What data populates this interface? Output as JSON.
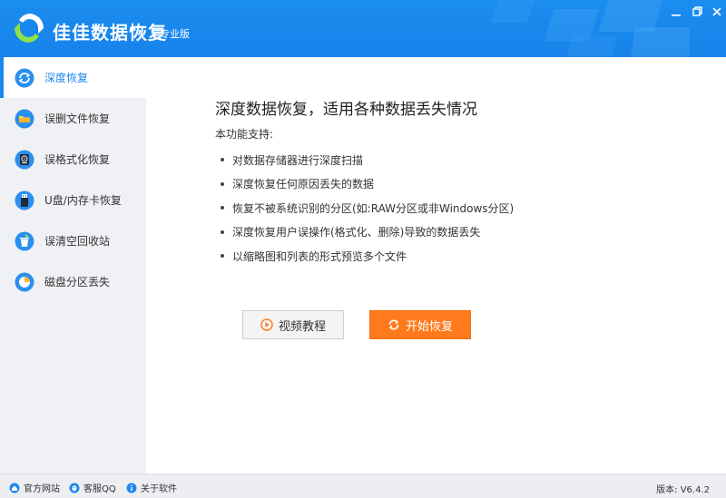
{
  "app": {
    "title": "佳佳数据恢复",
    "edition": "专业版"
  },
  "window_controls": {
    "minimize": "minimize-icon",
    "maximize": "maximize-icon",
    "close": "close-icon"
  },
  "sidebar": {
    "items": [
      {
        "label": "深度恢复",
        "icon": "refresh-icon",
        "active": true
      },
      {
        "label": "误删文件恢复",
        "icon": "folder-icon",
        "active": false
      },
      {
        "label": "误格式化恢复",
        "icon": "disk-icon",
        "active": false
      },
      {
        "label": "U盘/内存卡恢复",
        "icon": "usb-drive-icon",
        "active": false
      },
      {
        "label": "误清空回收站",
        "icon": "recycle-bin-icon",
        "active": false
      },
      {
        "label": "磁盘分区丢失",
        "icon": "partition-icon",
        "active": false
      }
    ]
  },
  "main": {
    "heading": "深度数据恢复，适用各种数据丢失情况",
    "subhead": "本功能支持:",
    "features": [
      "对数据存储器进行深度扫描",
      "深度恢复任何原因丢失的数据",
      "恢复不被系统识别的分区(如:RAW分区或非Windows分区)",
      "深度恢复用户误操作(格式化、删除)导致的数据丢失",
      "以缩略图和列表的形式预览多个文件"
    ],
    "video_button": "视频教程",
    "start_button": "开始恢复"
  },
  "statusbar": {
    "website": "官方网站",
    "qq": "客服QQ",
    "about": "关于软件",
    "version": "版本: V6.4.2"
  },
  "colors": {
    "brand_blue": "#1b8cf0",
    "accent_orange": "#ff7a1c"
  }
}
